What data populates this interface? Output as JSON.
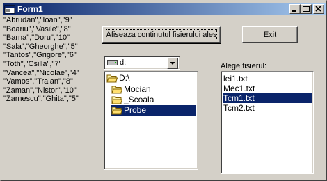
{
  "window": {
    "title": "Form1"
  },
  "names": [
    "\"Abrudan\",\"Ioan\",\"9\"",
    "\"Boariu\",\"Vasile\",\"8\"",
    "\"Barna\",\"Doru\",\"10\"",
    "\"Sala\",\"Gheorghe\",\"5\"",
    "\"Tantos\",\"Grigore\",\"6\"",
    "\"Toth\",\"Csilla\",\"7\"",
    "\"Vancea\",\"Nicolae\",\"4\"",
    "\"Vamos\",\"Traian\",\"8\"",
    "\"Zaman\",\"Nistor\",\"10\"",
    "\"Zarnescu\",\"Ghita\",\"5\""
  ],
  "buttons": {
    "show_label": "Afiseaza continutul fisierului ales",
    "exit_label": "Exit"
  },
  "drive": {
    "value": "d:"
  },
  "dirs": [
    "D:\\",
    "Mocian",
    "_Scoala",
    "Probe"
  ],
  "dir_selected": "Probe",
  "files_label": "Alege fisierul:",
  "files": [
    "lei1.txt",
    "Mec1.txt",
    "Tcm1.txt",
    "Tcm2.txt"
  ],
  "file_selected": "Tcm1.txt",
  "colors": {
    "selection": "#0a246a",
    "face": "#d4d0c8",
    "title_start": "#0a246a",
    "title_end": "#a6caf0"
  }
}
